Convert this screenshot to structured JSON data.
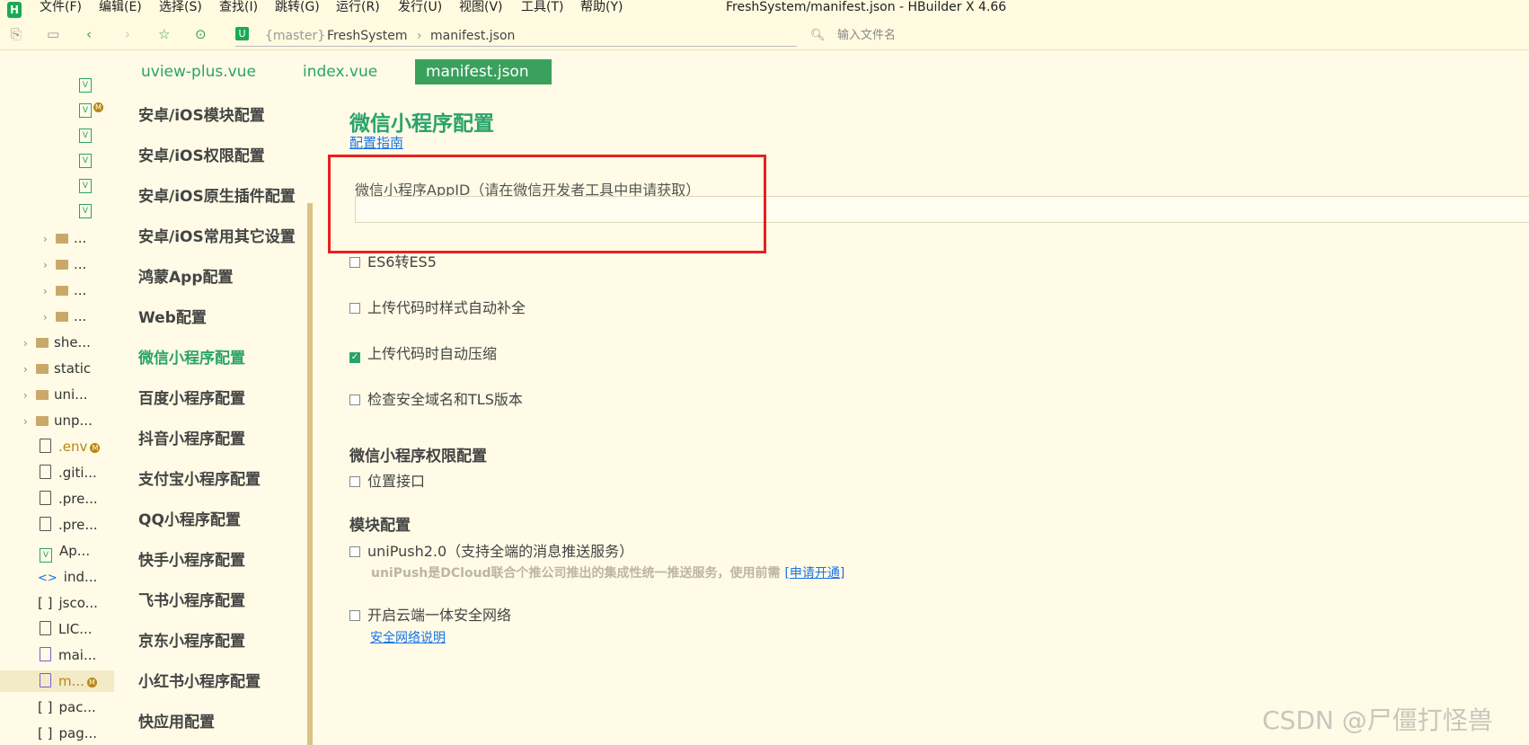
{
  "app": {
    "window_title": "FreshSystem/manifest.json - HBuilder X 4.66",
    "logo_letter": "H",
    "menu": [
      "文件(F)",
      "编辑(E)",
      "选择(S)",
      "查找(I)",
      "跳转(G)",
      "运行(R)",
      "发行(U)",
      "视图(V)",
      "工具(T)",
      "帮助(Y)"
    ]
  },
  "toolbar": {
    "vcs_letter": "U",
    "git_branch": "{master}",
    "project": "FreshSystem",
    "file": "manifest.json",
    "file_search_placeholder": "输入文件名"
  },
  "explorer": {
    "vue_files_top": [
      {
        "label": "V",
        "modified": false
      },
      {
        "label": "V",
        "modified": true
      },
      {
        "label": "V",
        "modified": false
      },
      {
        "label": "V",
        "modified": false
      },
      {
        "label": "V",
        "modified": false
      },
      {
        "label": "V",
        "modified": false
      }
    ],
    "modified_badge": "M",
    "subfolders": [
      "...",
      "...",
      "...",
      "..."
    ],
    "folders": [
      "she...",
      "static",
      "uni...",
      "unp..."
    ],
    "files": [
      {
        "name": ".env",
        "icon": "file",
        "modified": true
      },
      {
        "name": ".giti...",
        "icon": "file",
        "modified": false
      },
      {
        "name": ".pre...",
        "icon": "file",
        "modified": false
      },
      {
        "name": ".pre...",
        "icon": "file",
        "modified": false
      },
      {
        "name": "Ap...",
        "icon": "vue",
        "modified": false
      },
      {
        "name": "ind...",
        "icon": "html",
        "modified": false
      },
      {
        "name": "jsco...",
        "icon": "json",
        "modified": false
      },
      {
        "name": "LIC...",
        "icon": "file",
        "modified": false
      },
      {
        "name": "mai...",
        "icon": "js",
        "modified": false
      },
      {
        "name": "m...",
        "icon": "manifest",
        "modified": true,
        "selected": true
      },
      {
        "name": "pac...",
        "icon": "json",
        "modified": false
      },
      {
        "name": "pag...",
        "icon": "json",
        "modified": false
      }
    ]
  },
  "tabs": [
    {
      "label": "uview-plus.vue",
      "active": false
    },
    {
      "label": "index.vue",
      "active": false
    },
    {
      "label": "manifest.json",
      "active": true
    }
  ],
  "nav": [
    "安卓/iOS模块配置",
    "安卓/iOS权限配置",
    "安卓/iOS原生插件配置",
    "安卓/iOS常用其它设置",
    "鸿蒙App配置",
    "Web配置",
    "微信小程序配置",
    "百度小程序配置",
    "抖音小程序配置",
    "支付宝小程序配置",
    "QQ小程序配置",
    "快手小程序配置",
    "飞书小程序配置",
    "京东小程序配置",
    "小红书小程序配置",
    "快应用配置"
  ],
  "nav_active_index": 6,
  "content": {
    "title": "微信小程序配置",
    "guide_link": "配置指南",
    "appid_label": "微信小程序AppID（请在微信开发者工具中申请获取）",
    "appid_value": "",
    "options": [
      {
        "label": "ES6转ES5",
        "checked": false
      },
      {
        "label": "上传代码时样式自动补全",
        "checked": false
      },
      {
        "label": "上传代码时自动压缩",
        "checked": true
      },
      {
        "label": "检查安全域名和TLS版本",
        "checked": false
      }
    ],
    "permissions_title": "微信小程序权限配置",
    "permissions": [
      {
        "label": "位置接口",
        "checked": false
      }
    ],
    "modules_title": "模块配置",
    "unipush": {
      "label": "uniPush2.0（支持全端的消息推送服务）",
      "checked": false,
      "desc": "uniPush是DCloud联合个推公司推出的集成性统一推送服务，使用前需",
      "desc_link": "[申请开通]"
    },
    "secure_network": {
      "label": "开启云端一体安全网络",
      "checked": false,
      "link": "安全网络说明"
    }
  },
  "watermark": "CSDN @尸僵打怪兽",
  "colors": {
    "accent": "#2aa36b",
    "active_tab_bg": "#3aa15c",
    "link": "#1a73e8",
    "highlight_box": "#e8211d",
    "background": "#fffbe6"
  }
}
